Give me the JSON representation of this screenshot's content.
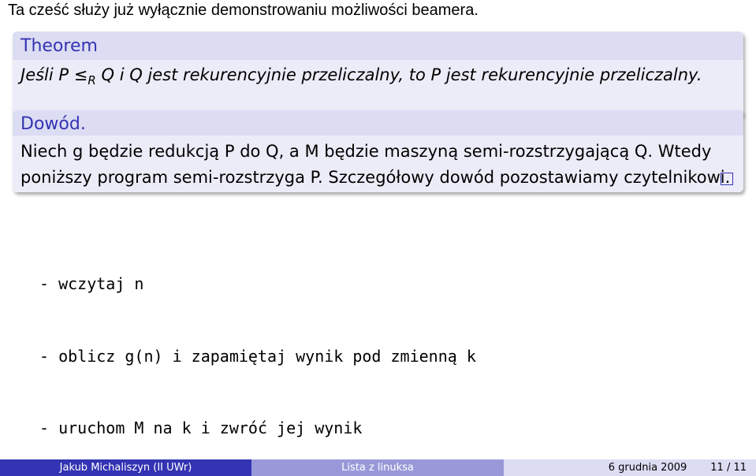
{
  "intro_text": "Ta cześć służy już wyłącznie demonstrowaniu możliwości beamera.",
  "theorem": {
    "title": "Theorem",
    "text_part1": "Jeśli P",
    "relation_symbol": "≤",
    "relation_subscript": "R",
    "text_part2": "Q i Q jest rekurencyjnie przeliczalny, to P jest rekurencyjnie przeliczalny."
  },
  "proof": {
    "title": "Dowód.",
    "line1": "Niech g będzie redukcją P do Q, a M będzie maszyną semi-rozstrzygającą Q. Wtedy",
    "line2": "poniższy program semi-rozstrzyga P. Szczegółowy dowód pozostawiamy czytelnikowi."
  },
  "program_lines": [
    "- wczytaj n",
    "- oblicz g(n) i zapamiętaj wynik pod zmienną k",
    "- uruchom M na k i zwróć jej wynik"
  ],
  "footer": {
    "author": "Jakub Michaliszyn  (II UWr)",
    "title": "Lista z linuksa",
    "date": "6 grudnia 2009",
    "page": "11 / 11"
  },
  "colors": {
    "accent": "#3333b3",
    "block_title_bg": "#dcdcf3",
    "block_body_bg": "#ececf8",
    "footer_mid_bg": "#9999d9"
  }
}
